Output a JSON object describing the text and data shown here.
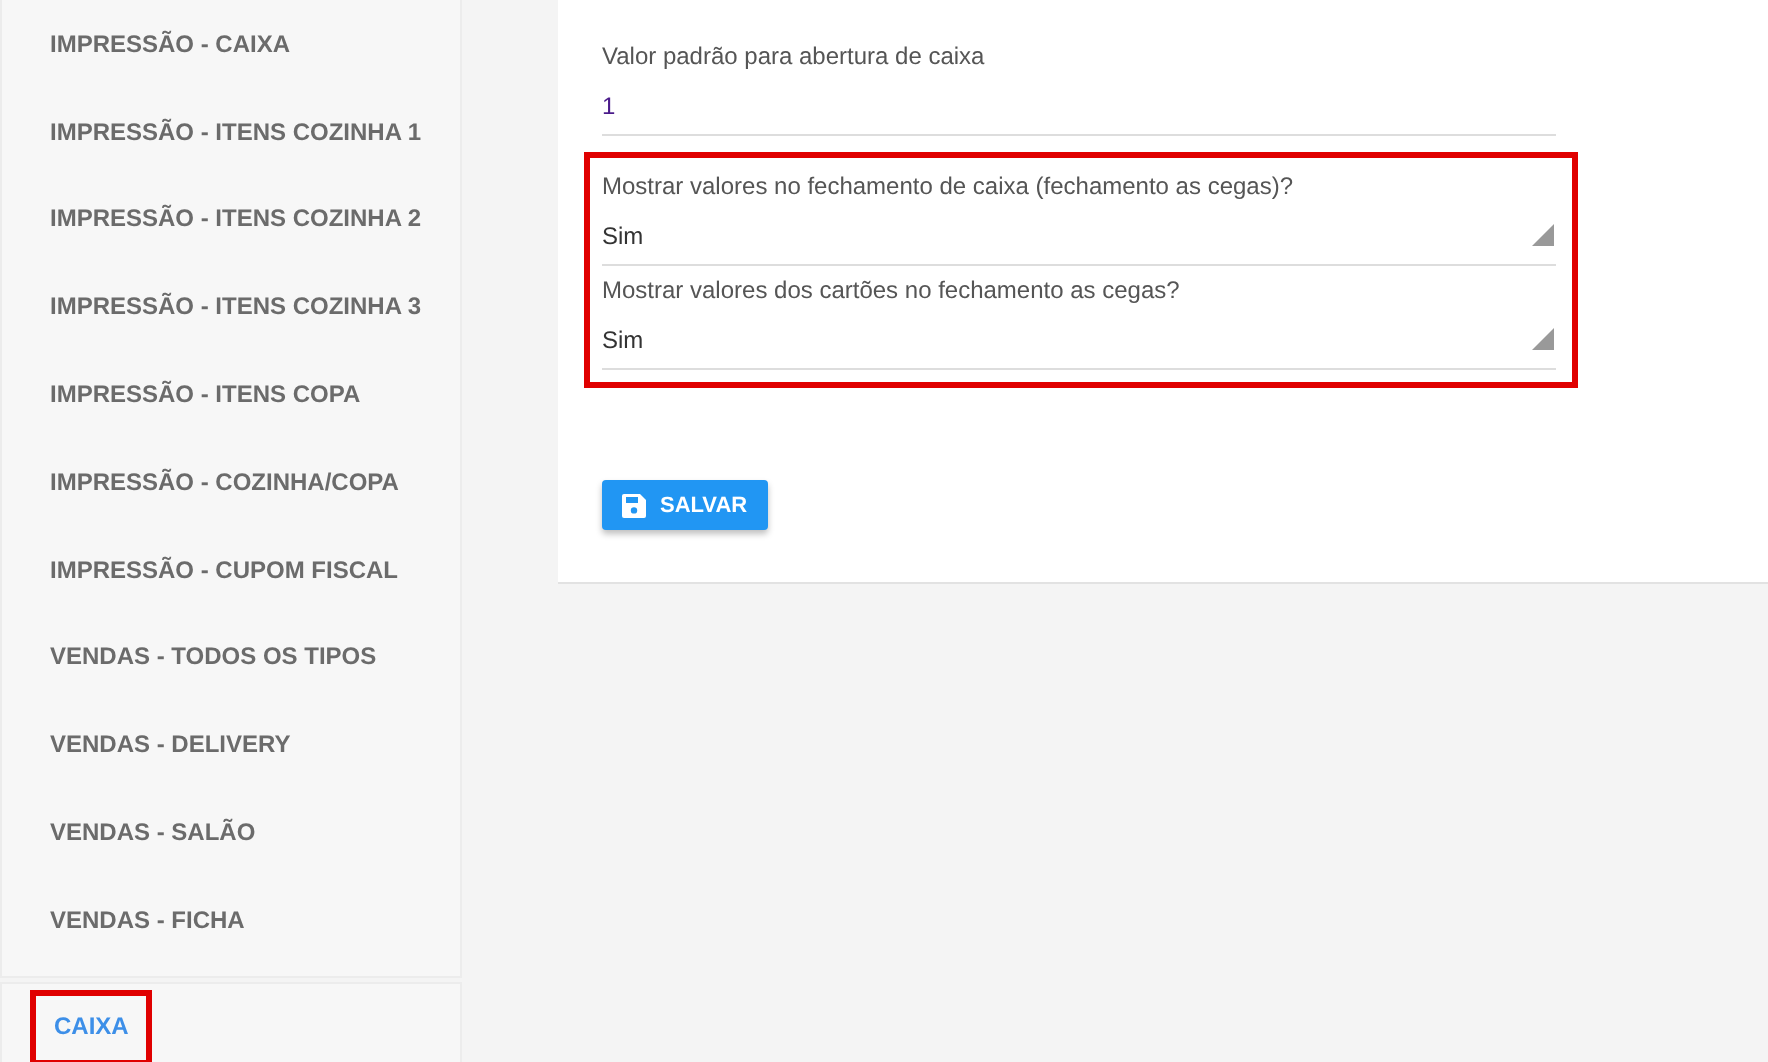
{
  "sidebar": {
    "items": [
      {
        "label": "IMPRESSÃO - CAIXA",
        "selected": false,
        "highlighted": false
      },
      {
        "label": "IMPRESSÃO - ITENS COZINHA 1",
        "selected": false,
        "highlighted": false
      },
      {
        "label": "IMPRESSÃO - ITENS COZINHA 2",
        "selected": false,
        "highlighted": false
      },
      {
        "label": "IMPRESSÃO - ITENS COZINHA 3",
        "selected": false,
        "highlighted": false
      },
      {
        "label": "IMPRESSÃO - ITENS COPA",
        "selected": false,
        "highlighted": false
      },
      {
        "label": "IMPRESSÃO - COZINHA/COPA",
        "selected": false,
        "highlighted": false
      },
      {
        "label": "IMPRESSÃO - CUPOM FISCAL",
        "selected": false,
        "highlighted": false
      },
      {
        "label": "VENDAS - TODOS OS TIPOS",
        "selected": false,
        "highlighted": false
      },
      {
        "label": "VENDAS - DELIVERY",
        "selected": false,
        "highlighted": false
      },
      {
        "label": "VENDAS - SALÃO",
        "selected": false,
        "highlighted": false
      },
      {
        "label": "VENDAS - FICHA",
        "selected": false,
        "highlighted": false
      },
      {
        "label": "CAIXA",
        "selected": true,
        "highlighted": true
      }
    ]
  },
  "form": {
    "fields": [
      {
        "kind": "text",
        "label": "Valor padrão para abertura de caixa",
        "value": "1",
        "highlighted": false
      },
      {
        "kind": "select",
        "label": "Mostrar valores no fechamento de caixa (fechamento as cegas)?",
        "value": "Sim",
        "highlighted": true
      },
      {
        "kind": "select",
        "label": "Mostrar valores dos cartões no fechamento as cegas?",
        "value": "Sim",
        "highlighted": true
      }
    ],
    "save_button": "SALVAR"
  }
}
